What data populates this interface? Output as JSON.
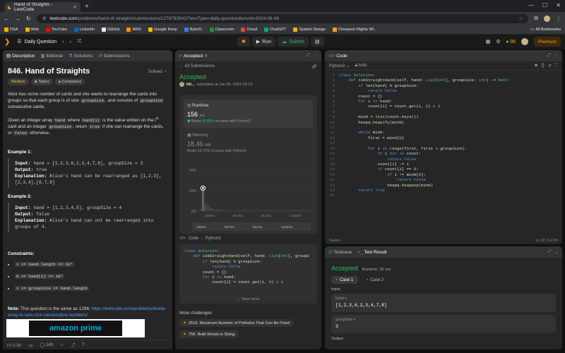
{
  "browser": {
    "tab_title": "Hand of Straights - LeetCode",
    "url_host": "leetcode.com",
    "url_path": "/problems/hand-of-straights/submissions/1279793542/?envType=daily-question&envId=2024-06-06",
    "bookmarks": [
      {
        "label": "DSA",
        "color": "#f5b400"
      },
      {
        "label": "Web",
        "color": "#f5b400"
      },
      {
        "label": "YouTube",
        "color": "#ff0000"
      },
      {
        "label": "LinkedIn",
        "color": "#0a66c2"
      },
      {
        "label": "GitHub",
        "color": "#e8eaed"
      },
      {
        "label": "AWS",
        "color": "#ff9900"
      },
      {
        "label": "Google Keep",
        "color": "#fbbc04"
      },
      {
        "label": "ByteXL",
        "color": "#3d7cf0"
      },
      {
        "label": "Classroom",
        "color": "#1e8e3e"
      },
      {
        "label": "Gmail",
        "color": "#ea4335"
      },
      {
        "label": "ChatGPT",
        "color": "#10a37f"
      },
      {
        "label": "System Design",
        "color": "#f5b400"
      },
      {
        "label": "Cheapest Flights Wi...",
        "color": "#ffa116"
      }
    ],
    "all_bookmarks": "All Bookmarks"
  },
  "lc_nav": {
    "problem_list": "Daily Question",
    "run": "Run",
    "submit": "Submit",
    "streak": "98",
    "premium": "Premium"
  },
  "description": {
    "tabs": [
      "Description",
      "Editorial",
      "Solutions",
      "Submissions"
    ],
    "title": "846. Hand of Straights",
    "solved": "Solved",
    "difficulty": "Medium",
    "tags": [
      "Topics",
      "Companies"
    ],
    "p1": "Alice has some number of cards and she wants to rearrange the cards into groups so that each group is of size",
    "p1_code": "groupSize",
    "p1_end": ", and consists of",
    "p1_code2": "groupSize",
    "p1_end2": "consecutive cards.",
    "p2a": "Given an integer array",
    "p2_hand": "hand",
    "p2b": "where",
    "p2_handi": "hand[i]",
    "p2c": "is the value written on the i",
    "p2_sup": "th",
    "p2d": "card and an integer",
    "p2_gs": "groupSize",
    "p2e": ", return",
    "p2_true": "true",
    "p2f": "if she can rearrange the cards, or",
    "p2_false": "false",
    "p2g": "otherwise.",
    "examples": [
      {
        "heading": "Example 1:",
        "input": "hand = [1,2,3,6,2,3,4,7,8], groupSize = 3",
        "output": "true",
        "explanation": "Alice's hand can be rearranged as [1,2,3],[2,3,4],[6,7,8]"
      },
      {
        "heading": "Example 2:",
        "input": "hand = [1,2,3,4,5], groupSize = 4",
        "output": "false",
        "explanation": "Alice's hand can not be rearranged into groups of 4."
      }
    ],
    "input_label": "Input:",
    "output_label": "Output:",
    "explanation_label": "Explanation:",
    "constraints_heading": "Constraints:",
    "constraints": [
      "1 <= hand.length <= 10⁴",
      "0 <= hand[i] <= 10⁹",
      "1 <= groupSize <= hand.length"
    ],
    "note_label": "Note:",
    "note": "This question is the same as 1296:",
    "note_link": "https://leetcode.com/problems/divide-array-in-sets-of-k-consecutive-numbers/",
    "ad_text": "amazon prime",
    "likes": "3.1K",
    "comments": "149"
  },
  "accepted": {
    "tab": "Accepted",
    "back": "All Submissions",
    "status": "Accepted",
    "user": "Nil...",
    "submitted": "submitted at Jun 06, 2024 23:13",
    "editorial_btn": "Editorial",
    "solution_btn": "Solution",
    "runtime_label": "Runtime",
    "runtime_value": "156",
    "runtime_unit": "ms",
    "runtime_beats_label": "Beats",
    "runtime_beats": "90.80%",
    "runtime_beats_suffix": "of users with Python3",
    "memory_label": "Memory",
    "memory_value": "18.46",
    "memory_unit": "MB",
    "memory_beats_label": "Beats",
    "memory_beats": "53.75%",
    "memory_beats_suffix": "of users with Python3",
    "code_label": "Code",
    "code_lang": "Python3",
    "view_more": "View more",
    "more_challenges": "More challenges",
    "challenges": [
      "3119. Maximum Number of Potholes That Can Be Fixed",
      "758. Bold Words in String"
    ]
  },
  "chart_data": {
    "type": "bar",
    "yticks": [
      "50%",
      "25%",
      "0%"
    ],
    "ylim": [
      0,
      50
    ],
    "xticks": [
      "105ms",
      "557ms",
      "911ms",
      "1315ms"
    ],
    "mini_xticks": [
      "105ms",
      "507ms",
      "911ms",
      "1315ms"
    ],
    "values": [
      2,
      28,
      10,
      7,
      4,
      3,
      2,
      2,
      1,
      1,
      1,
      1,
      1,
      1,
      1,
      1,
      1,
      1,
      1,
      1,
      1,
      1,
      1,
      1,
      1,
      1,
      1,
      1,
      1,
      1,
      1,
      1,
      1,
      1,
      1,
      1,
      1,
      1,
      1,
      1,
      1,
      1,
      1,
      1
    ],
    "highlight_index": 1,
    "bar_color": "#4a4a4a",
    "highlight_color": "#ffffff"
  },
  "code_panel": {
    "tab": "Code",
    "lang": "Python3",
    "auto": "Auto",
    "saved": "Saved",
    "cursor": "Ln 22, Col 39"
  },
  "testresult": {
    "tabs": [
      "Testcase",
      "Test Result"
    ],
    "status": "Accepted",
    "runtime": "Runtime: 32 ms",
    "cases": [
      "Case 1",
      "Case 2"
    ],
    "input_label": "Input",
    "hand_key": "hand =",
    "hand_val": "[1,2,3,6,2,3,4,7,8]",
    "gs_key": "groupSize =",
    "gs_val": "3",
    "output_label": "Output"
  }
}
